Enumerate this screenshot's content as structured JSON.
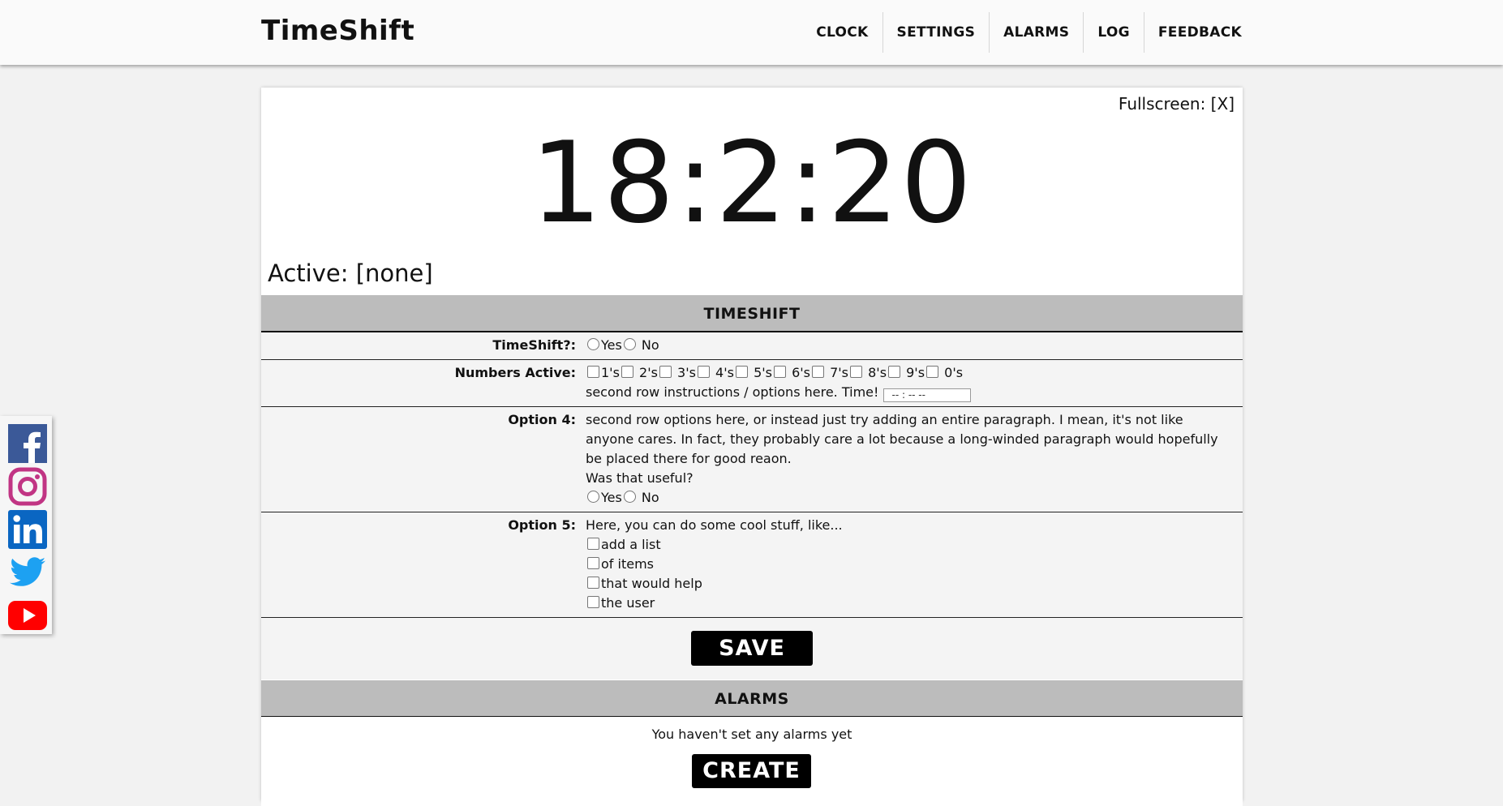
{
  "header": {
    "brand": "TimeShift",
    "nav": [
      "CLOCK",
      "SETTINGS",
      "ALARMS",
      "LOG",
      "FEEDBACK"
    ]
  },
  "social": [
    "facebook-icon",
    "instagram-icon",
    "linkedin-icon",
    "twitter-icon",
    "youtube-icon"
  ],
  "clock": {
    "fullscreen": "Fullscreen: [X]",
    "time": "18:2:20",
    "active": "Active: [none]"
  },
  "timeshift": {
    "heading": "TIMESHIFT",
    "timeshift_label": "TimeShift?:",
    "yes": "Yes",
    "no": "No",
    "numbers_label": "Numbers Active:",
    "numbers": [
      "1's",
      "2's",
      "3's",
      "4's",
      "5's",
      "6's",
      "7's",
      "8's",
      "9's",
      "0's"
    ],
    "second_row": "second row instructions / options here. Time!",
    "time_placeholder": "-- : --   --",
    "option4_label": "Option 4:",
    "option4_text": "second row options here, or instead just try adding an entire paragraph. I mean, it's not like anyone cares. In fact, they probably care a lot because a long-winded paragraph would hopefully be placed there for good reaon.",
    "option4_question": "Was that useful?",
    "option5_label": "Option 5:",
    "option5_text": "Here, you can do some cool stuff, like...",
    "option5_items": [
      "add a list",
      "of items",
      "that would help",
      "the user"
    ],
    "save": "SAVE"
  },
  "alarms": {
    "heading": "ALARMS",
    "empty": "You haven't set any alarms yet",
    "create": "CREATE"
  },
  "colors": {
    "facebook": "#3b5998",
    "instagram": "#c13584",
    "linkedin": "#0a66c2",
    "twitter": "#1da1f2",
    "youtube": "#ff0000"
  }
}
